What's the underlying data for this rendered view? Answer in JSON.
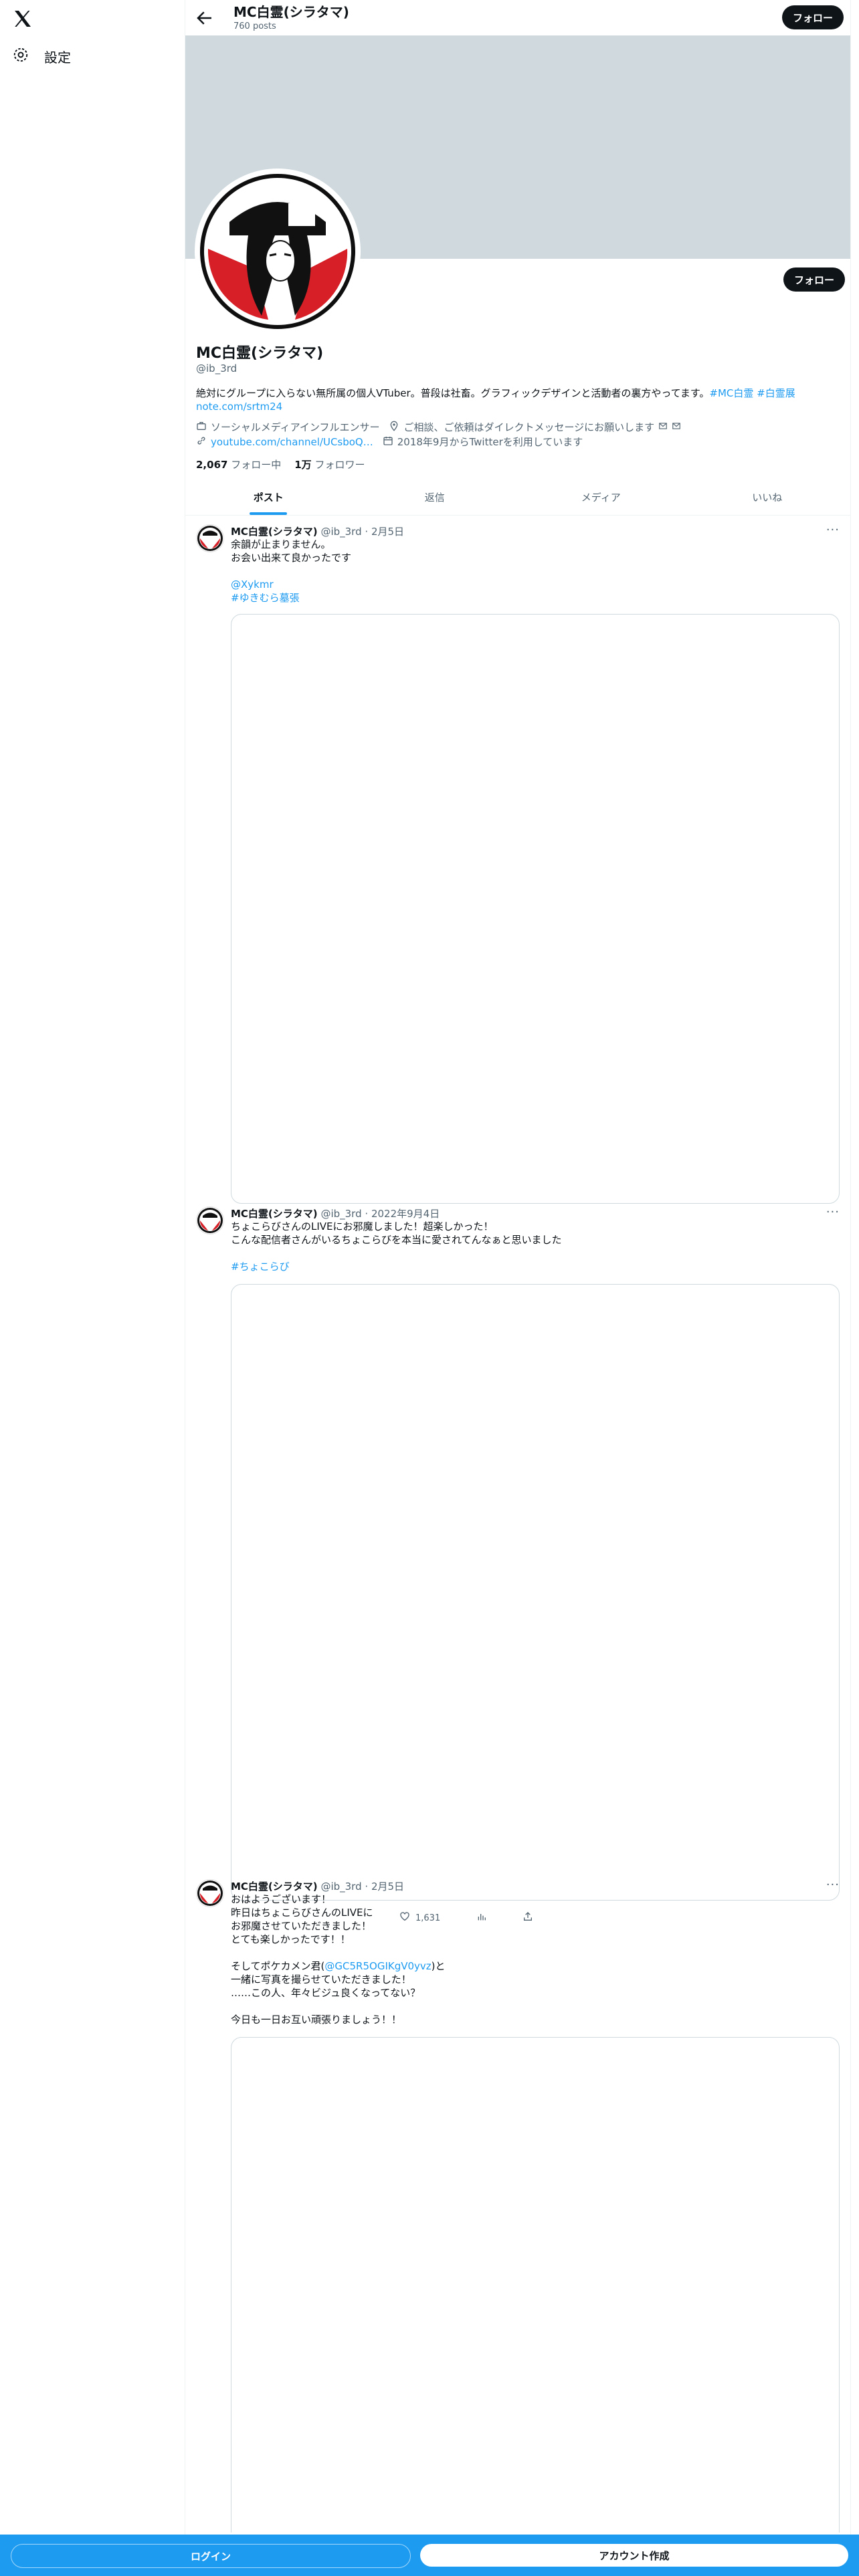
{
  "sidebar": {
    "settings_label": "設定"
  },
  "topbar": {
    "name": "MC白霊(シラタマ)",
    "posts": "760 posts",
    "follow": "フォロー"
  },
  "profile": {
    "follow": "フォロー",
    "name": "MC白霊(シラタマ)",
    "handle": "@ib_3rd",
    "bio_text": "絶対にグループに入らない無所属の個人VTuber。普段は社畜。グラフィックデザインと活動者の裏方やってます。",
    "bio_tags": "#MC白霊 #白霊展",
    "bio_link": "note.com/srtm24",
    "meta_category": "ソーシャルメディアインフルエンサー",
    "meta_location": "ご相談、ご依頼はダイレクトメッセージにお願いします",
    "meta_url": "youtube.com/channel/UCsboQ…",
    "meta_joined": "2018年9月からTwitterを利用しています",
    "following_count": "2,067",
    "following_label": "フォロー中",
    "followers_count": "1万",
    "followers_label": "フォロワー"
  },
  "tabs": [
    "ポスト",
    "返信",
    "メディア",
    "いいね"
  ],
  "tweets": [
    {
      "name": "MC白霊(シラタマ)",
      "handle": "@ib_3rd",
      "date": "2月5日",
      "text": "余韻が止まりません。\nお会い出来て良かったです",
      "mention": "@Xykmr",
      "tag": "#ゆきむら墓張"
    },
    {
      "name": "MC白霊(シラタマ)",
      "handle": "@ib_3rd",
      "date": "2022年9月4日",
      "text": "ちょこらびさんのLIVEにお邪魔しました！超楽しかった！\nこんな配信者さんがいるちょこらびを本当に愛されてんなぁと思いました",
      "tag": "#ちょこらび"
    },
    {
      "name": "MC白霊(シラタマ)",
      "handle": "@ib_3rd",
      "date": "2月5日",
      "text1": "おはようございます！\n昨日はちょこらびさんのLIVEに\nお邪魔させていただきました！\nとても楽しかったです！！",
      "text2_pre": "そしてポケカメン君(",
      "text2_mention": "@GC5R5OGIKgV0yvz",
      "text2_post": ")と\n一緒に写真を撮らせていただきました！\n……この人、年々ビジュ良くなってない？",
      "text3": "今日も一日お互い頑張りましょう！！",
      "likes": "1,631"
    }
  ],
  "bottom": {
    "login": "ログイン",
    "signup": "アカウント作成"
  }
}
